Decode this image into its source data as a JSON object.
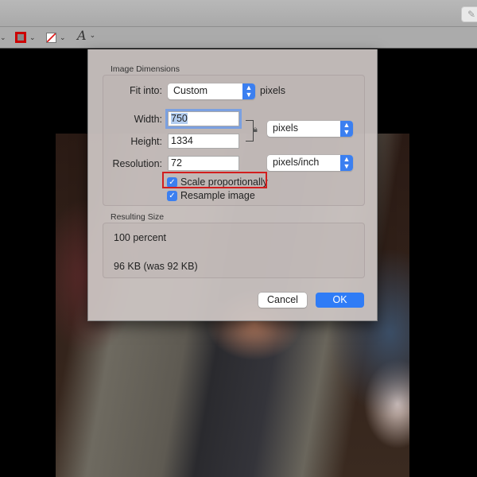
{
  "toolbar": {
    "border_color": "#cc0000",
    "text_tool": "A",
    "chevron": "⌄"
  },
  "dialog": {
    "image_dimensions_label": "Image Dimensions",
    "fit_into_label": "Fit into:",
    "fit_into_value": "Custom",
    "fit_into_unit": "pixels",
    "width_label": "Width:",
    "width_value": "750",
    "height_label": "Height:",
    "height_value": "1334",
    "size_unit": "pixels",
    "resolution_label": "Resolution:",
    "resolution_value": "72",
    "resolution_unit": "pixels/inch",
    "scale_proportionally": {
      "label": "Scale proportionally",
      "checked": true
    },
    "resample_image": {
      "label": "Resample image",
      "checked": true
    },
    "resulting_size_label": "Resulting Size",
    "percent": "100 percent",
    "size": "96 KB (was 92 KB)",
    "cancel": "Cancel",
    "ok": "OK"
  },
  "colors": {
    "accent": "#2f7cf6",
    "highlight": "#d21e1e"
  }
}
